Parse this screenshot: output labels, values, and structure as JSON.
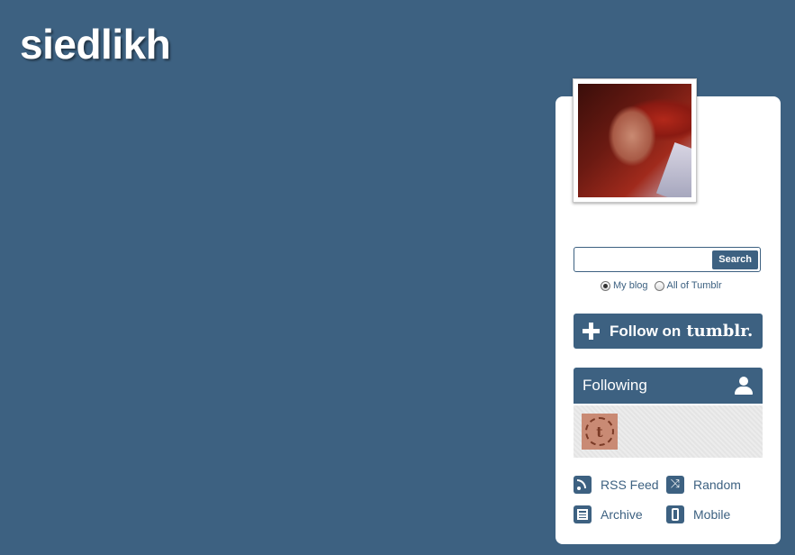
{
  "blog": {
    "title": "siedlikh"
  },
  "search": {
    "placeholder": "",
    "value": "",
    "button_label": "Search"
  },
  "scope": {
    "my_blog_label": "My blog",
    "all_label": "All of Tumblr",
    "selected": "My blog"
  },
  "follow": {
    "label": "Follow on",
    "brand": "tumblr."
  },
  "following": {
    "header": "Following",
    "avatar_letter": "t"
  },
  "links": {
    "rss": "RSS Feed",
    "random": "Random",
    "archive": "Archive",
    "mobile": "Mobile"
  },
  "colors": {
    "background": "#3d6181",
    "panel": "#ffffff",
    "accent": "#3d6181"
  },
  "icons": [
    "plus-icon",
    "person-icon",
    "rss-icon",
    "shuffle-icon",
    "archive-icon",
    "mobile-icon"
  ]
}
